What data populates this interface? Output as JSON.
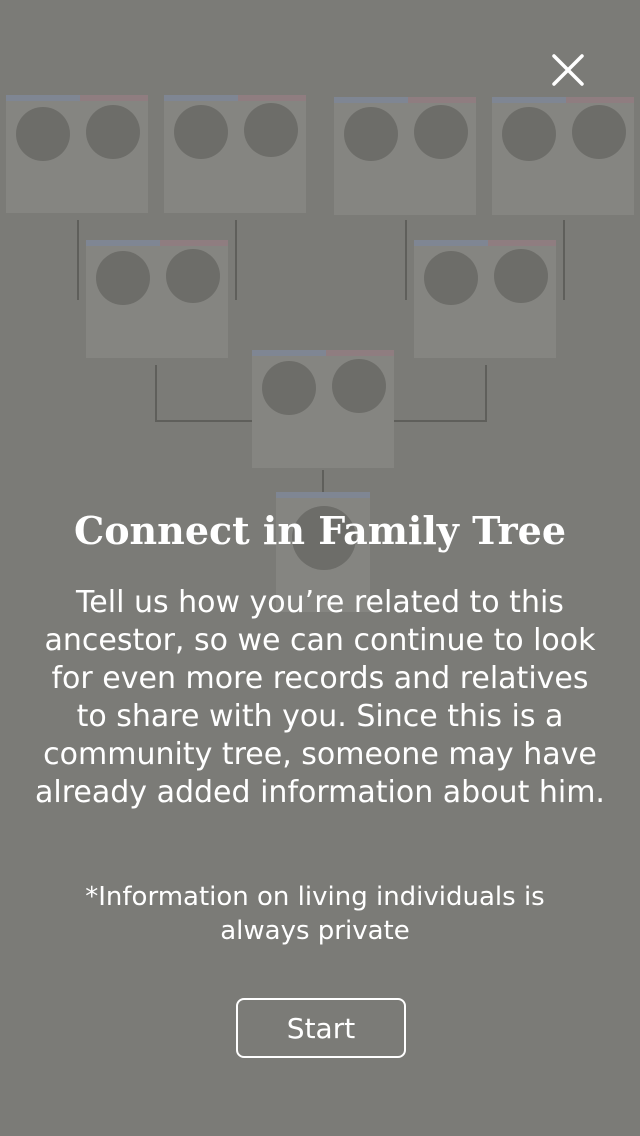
{
  "modal": {
    "title": "Connect in Family Tree",
    "body": "Tell us how you’re related to this ancestor, so we can continue to look for even more records and relatives to share with you. Since this is a community tree, someone may have already added information about him.",
    "note": "*Information on living individuals is always private",
    "start_label": "Start",
    "close_icon": "close-icon"
  },
  "colors": {
    "overlay": "#7b7b77",
    "text": "#ffffff",
    "male_bar": "#7f8693",
    "female_bar": "#8f7d80"
  }
}
